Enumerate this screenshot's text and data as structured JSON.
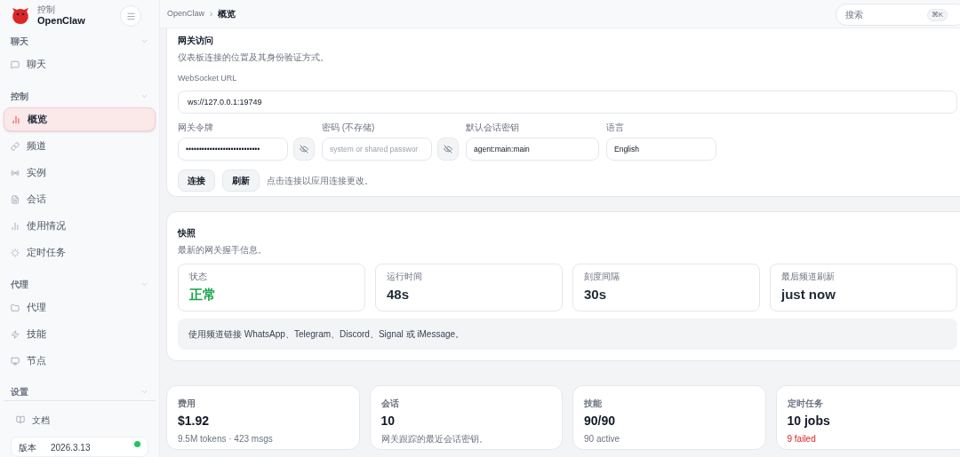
{
  "brand": {
    "subtitle": "控制",
    "title": "OpenClaw"
  },
  "sidebar": {
    "sections": [
      {
        "label": "聊天",
        "items": [
          {
            "label": "聊天",
            "selected": false
          }
        ]
      },
      {
        "label": "控制",
        "items": [
          {
            "label": "概览",
            "selected": true
          },
          {
            "label": "频道",
            "selected": false
          },
          {
            "label": "实例",
            "selected": false
          },
          {
            "label": "会话",
            "selected": false
          },
          {
            "label": "使用情况",
            "selected": false
          },
          {
            "label": "定时任务",
            "selected": false
          }
        ]
      },
      {
        "label": "代理",
        "items": [
          {
            "label": "代理",
            "selected": false
          },
          {
            "label": "技能",
            "selected": false
          },
          {
            "label": "节点",
            "selected": false
          }
        ]
      },
      {
        "label": "设置"
      }
    ],
    "docs": "文档",
    "version": {
      "label": "版本",
      "value": "2026.3.13",
      "color": "#22c55e"
    }
  },
  "breadcrumb": [
    "OpenClaw",
    "概览"
  ],
  "breadcrumb_separator": "›",
  "search": {
    "placeholder": "搜索",
    "shortcut": "⌘K"
  },
  "gateway": {
    "title": "网关访问",
    "subtitle": "仪表板连接的位置及其身份验证方式。",
    "url_label": "WebSocket URL",
    "url": "ws://127.0.0.1:19749",
    "fields": [
      {
        "label": "网关令牌",
        "value": "••••••••••••••••••••••••••••",
        "kind": "secret"
      },
      {
        "label": "密码 (不存储)",
        "placeholder": "system or shared passwor",
        "kind": "secret"
      },
      {
        "label": "默认会话密钥",
        "value": "agent:main:main",
        "kind": "text"
      },
      {
        "label": "语言",
        "value": "English",
        "kind": "text"
      }
    ],
    "buttons": [
      "连接",
      "刷新"
    ],
    "hint": "点击连接以应用连接更改。"
  },
  "snapshot": {
    "title": "快照",
    "subtitle": "最新的网关握手信息。",
    "stats": [
      {
        "label": "状态",
        "value": "正常",
        "healthy": true
      },
      {
        "label": "运行时间",
        "value": "48s",
        "healthy": false
      },
      {
        "label": "刻度间隔",
        "value": "30s",
        "healthy": false
      },
      {
        "label": "最后频道刷新",
        "value": "just now",
        "healthy": false
      }
    ],
    "note": "使用频道链接 WhatsApp、Telegram、Discord、Signal 或 iMessage。"
  },
  "summary": [
    {
      "label": "费用",
      "value": "$1.92",
      "detail": "9.5M tokens · 423 msgs",
      "error": false
    },
    {
      "label": "会话",
      "value": "10",
      "detail": "网关跟踪的最近会话密钥。",
      "error": false
    },
    {
      "label": "技能",
      "value": "90/90",
      "detail": "90 active",
      "error": false
    },
    {
      "label": "定时任务",
      "value": "10 jobs",
      "detail": "9 failed",
      "error": true
    }
  ]
}
